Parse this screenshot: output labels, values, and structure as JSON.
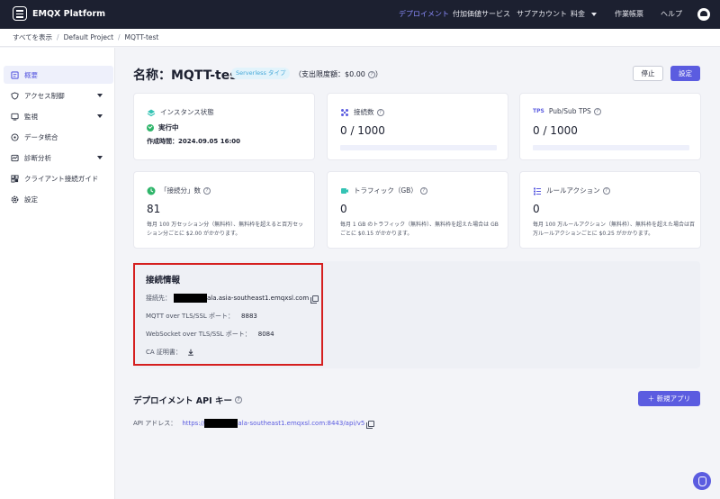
{
  "app": {
    "name": "EMQX Platform"
  },
  "nav": {
    "items": [
      {
        "label": "デプロイメント",
        "active": true
      },
      {
        "label": "付加価値サービス",
        "active": false
      },
      {
        "label": "サブアカウント",
        "active": false
      },
      {
        "label": "料金",
        "active": false,
        "dropdown": true
      },
      {
        "label": "作業帳票",
        "active": false
      },
      {
        "label": "ヘルプ",
        "active": false
      }
    ]
  },
  "breadcrumb": [
    "すべてを表示",
    "Default Project",
    "MQTT-test"
  ],
  "sidebar": {
    "items": [
      {
        "label": "概要",
        "icon": "overview-icon",
        "active": true
      },
      {
        "label": "アクセス制御",
        "icon": "shield-icon",
        "expandable": true
      },
      {
        "label": "監視",
        "icon": "monitor-icon",
        "expandable": true
      },
      {
        "label": "データ統合",
        "icon": "integration-icon"
      },
      {
        "label": "診断分析",
        "icon": "diagnosis-icon",
        "expandable": true
      },
      {
        "label": "クライアント接続ガイド",
        "icon": "guide-icon"
      },
      {
        "label": "設定",
        "icon": "gear-icon"
      }
    ]
  },
  "header": {
    "title": "名称：MQTT-test",
    "badge": "Serverless タイプ",
    "spend_limit": "（支出限度額：$0.00",
    "spend_limit_close": "）",
    "stop_label": "停止",
    "settings_label": "設定"
  },
  "cards": {
    "instance": {
      "label": "インスタンス状態",
      "status": "実行中",
      "created": "作成時間：2024.09.05 16:00"
    },
    "connections": {
      "label": "接続数",
      "value": "0 / 1000"
    },
    "tps": {
      "label": "Pub/Sub TPS",
      "icon_text": "TPS",
      "value": "0 / 1000"
    },
    "conn_minutes": {
      "label": "「接続分」数",
      "value": "81",
      "desc": "毎月 100 万セッション分（無料枠）、無料枠を超えると百万セッション分ごとに $2.00 がかかります。"
    },
    "traffic": {
      "label": "トラフィック（GB）",
      "value": "0",
      "desc": "毎月 1 GB のトラフィック（無料枠）、無料枠を超えた場合は GB ごとに $0.15 がかかります。"
    },
    "rule_actions": {
      "label": "ルールアクション",
      "value": "0",
      "desc": "毎月 100 万ルールアクション（無料枠）、無料枠を超えた場合は百万ルールアクションごとに $0.25 がかかります。"
    }
  },
  "connection_info": {
    "title": "接続情報",
    "address_label": "接続先：",
    "address_suffix": "ala.asia-southeast1.emqxsl.com",
    "mqtt_label": "MQTT over TLS/SSL ポート：",
    "mqtt_port": "8883",
    "ws_label": "WebSocket over TLS/SSL ポート：",
    "ws_port": "8084",
    "ca_label": "CA 証明書："
  },
  "api": {
    "title": "デプロイメント API キー",
    "new_app_label": "＋ 新規アプリ",
    "address_label": "API アドレス：",
    "address_prefix": "https://",
    "address_suffix": "ala-southeast1.emqxsl.com:8443/api/v5"
  },
  "colors": {
    "accent": "#5b5ce0",
    "topbar": "#1c2030",
    "highlight_border": "#d51f1f",
    "status_ok": "#2fb56a"
  }
}
